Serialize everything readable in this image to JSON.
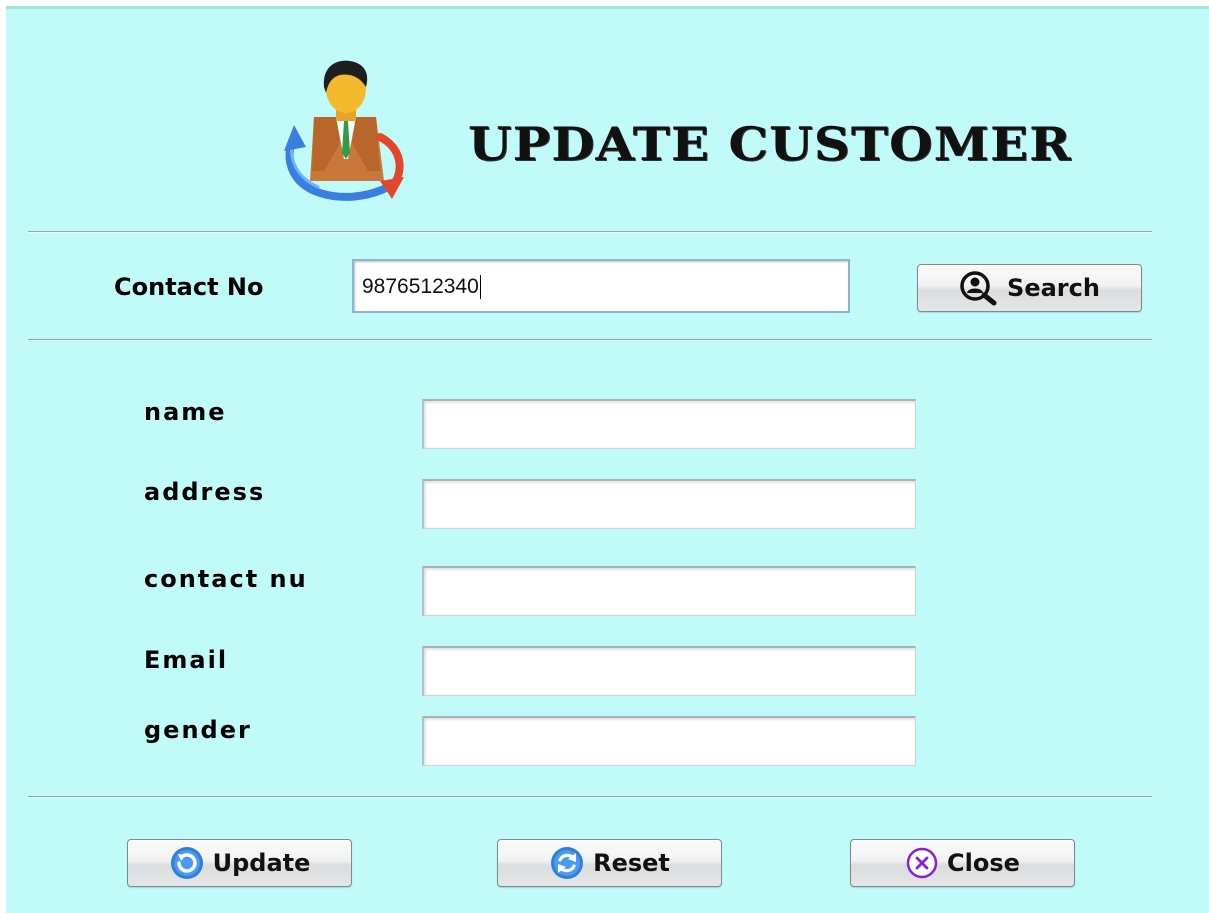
{
  "header": {
    "title": "UPDATE CUSTOMER",
    "icon": "customer-update-icon"
  },
  "search": {
    "label": "Contact No",
    "value": "9876512340",
    "button_label": "Search",
    "button_icon": "search-user-icon"
  },
  "form": {
    "fields": [
      {
        "label": "name",
        "value": ""
      },
      {
        "label": "address",
        "value": ""
      },
      {
        "label": "contact nu",
        "value": ""
      },
      {
        "label": "Email",
        "value": ""
      },
      {
        "label": "gender",
        "value": ""
      }
    ]
  },
  "actions": {
    "update_label": "Update",
    "update_icon": "refresh-icon",
    "reset_label": "Reset",
    "reset_icon": "reset-icon",
    "close_label": "Close",
    "close_icon": "close-icon"
  },
  "colors": {
    "background": "#c0fbf9",
    "separator": "#9aa5a6",
    "input_border_focused": "#8bb4d8"
  }
}
